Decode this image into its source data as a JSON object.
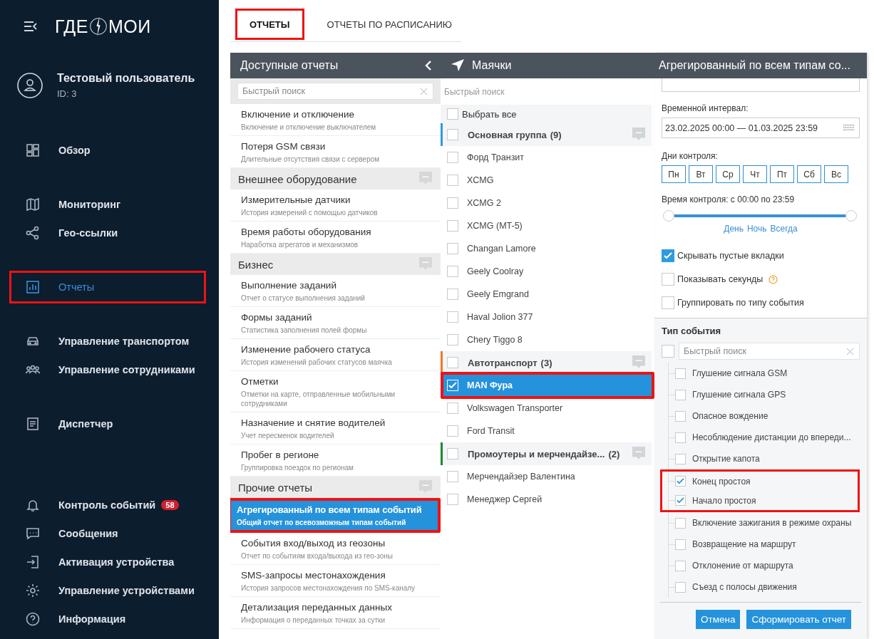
{
  "sidebar": {
    "logo": {
      "left": "ГДЕ",
      "right": "МОИ"
    },
    "user": {
      "name": "Тестовый пользователь",
      "id": "ID: 3"
    },
    "groups": [
      [
        {
          "label": "Обзор",
          "selected": false,
          "highlighted": false
        }
      ],
      [
        {
          "label": "Мониторинг",
          "selected": false,
          "highlighted": false
        },
        {
          "label": "Гео-ссылки",
          "selected": false,
          "highlighted": false
        }
      ],
      [
        {
          "label": "Отчеты",
          "selected": true,
          "highlighted": true
        }
      ],
      [
        {
          "label": "Управление транспортом",
          "selected": false,
          "highlighted": false
        },
        {
          "label": "Управление сотрудниками",
          "selected": false,
          "highlighted": false
        }
      ],
      [
        {
          "label": "Диспетчер",
          "selected": false,
          "highlighted": false
        }
      ],
      [
        {
          "label": "Контроль событий",
          "badge": "58",
          "selected": false,
          "highlighted": false
        },
        {
          "label": "Сообщения",
          "selected": false,
          "highlighted": false
        },
        {
          "label": "Активация устройства",
          "selected": false,
          "highlighted": false
        },
        {
          "label": "Управление устройствами",
          "selected": false,
          "highlighted": false
        },
        {
          "label": "Информация",
          "selected": false,
          "highlighted": false
        }
      ]
    ]
  },
  "tabs": [
    {
      "label": "ОТЧЕТЫ",
      "selected": true,
      "highlighted": true
    },
    {
      "label": "ОТЧЕТЫ ПО РАСПИСАНИЮ",
      "selected": false,
      "highlighted": false
    }
  ],
  "reports": {
    "title": "Доступные отчеты",
    "search": {
      "placeholder": "Быстрый поиск"
    },
    "rows": [
      {
        "kind": "item",
        "title": "Включение и отключение",
        "description": "Включение и отключение выключателем",
        "selected": false,
        "highlighted": false
      },
      {
        "kind": "item",
        "title": "Потеря GSM связи",
        "description": "Длительные отсутствия связи с сервером",
        "selected": false,
        "highlighted": false
      },
      {
        "kind": "group",
        "title": "Внешнее оборудование"
      },
      {
        "kind": "item",
        "title": "Измерительные датчики",
        "description": "История измерений с помощью датчиков",
        "selected": false,
        "highlighted": false
      },
      {
        "kind": "item",
        "title": "Время работы оборудования",
        "description": "Наработка агрегатов и механизмов",
        "selected": false,
        "highlighted": false
      },
      {
        "kind": "group",
        "title": "Бизнес"
      },
      {
        "kind": "item",
        "title": "Выполнение заданий",
        "description": "Отчет о статусе выполнения заданий",
        "selected": false,
        "highlighted": false
      },
      {
        "kind": "item",
        "title": "Формы заданий",
        "description": "Статистика заполнения полей формы",
        "selected": false,
        "highlighted": false
      },
      {
        "kind": "item",
        "title": "Изменение рабочего статуса",
        "description": "История изменений рабочих статусов маячка",
        "selected": false,
        "highlighted": false
      },
      {
        "kind": "item",
        "title": "Отметки",
        "description": "Отметки на карте, отправленные мобильными сотрудниками",
        "selected": false,
        "highlighted": false
      },
      {
        "kind": "item",
        "title": "Назначение и снятие водителей",
        "description": "Учет пересменок водителей",
        "selected": false,
        "highlighted": false
      },
      {
        "kind": "item",
        "title": "Пробег в регионе",
        "description": "Группировка поездок по регионам",
        "selected": false,
        "highlighted": false
      },
      {
        "kind": "group",
        "title": "Прочие отчеты"
      },
      {
        "kind": "item",
        "title": "Агрегированный по всем типам событий",
        "description": "Общий отчет по всевозможным типам событий",
        "selected": true,
        "highlighted": true
      },
      {
        "kind": "item",
        "title": "События вход/выход из геозоны",
        "description": "Отчет по событиям входа/выхода из гео-зоны",
        "selected": false,
        "highlighted": false
      },
      {
        "kind": "item",
        "title": "SMS-запросы местонахождения",
        "description": "История запросов местонахождения по SMS-каналу",
        "selected": false,
        "highlighted": false
      },
      {
        "kind": "item",
        "title": "Детализация переданных данных",
        "description": "Информация о переданных точках за сутки",
        "selected": false,
        "highlighted": false
      }
    ]
  },
  "beacons": {
    "title": "Маячки",
    "search": {
      "placeholder": "Быстрый поиск"
    },
    "select_all": {
      "label": "Выбрать все",
      "checked": false
    },
    "rows": [
      {
        "kind": "group",
        "label": "Основная группа",
        "count": "(9)",
        "color": "#2d9be0",
        "checked": false
      },
      {
        "kind": "item",
        "label": "Форд Транзит",
        "checked": false,
        "selected": false,
        "highlighted": false
      },
      {
        "kind": "item",
        "label": "XCMG",
        "checked": false,
        "selected": false,
        "highlighted": false
      },
      {
        "kind": "item",
        "label": "XCMG 2",
        "checked": false,
        "selected": false,
        "highlighted": false
      },
      {
        "kind": "item",
        "label": "XCMG (MT-5)",
        "checked": false,
        "selected": false,
        "highlighted": false
      },
      {
        "kind": "item",
        "label": "Changan Lamore",
        "checked": false,
        "selected": false,
        "highlighted": false
      },
      {
        "kind": "item",
        "label": "Geely Coolray",
        "checked": false,
        "selected": false,
        "highlighted": false
      },
      {
        "kind": "item",
        "label": "Geely Emgrand",
        "checked": false,
        "selected": false,
        "highlighted": false
      },
      {
        "kind": "item",
        "label": "Haval Jolion 377",
        "checked": false,
        "selected": false,
        "highlighted": false
      },
      {
        "kind": "item",
        "label": "Chery Tiggo 8",
        "checked": false,
        "selected": false,
        "highlighted": false
      },
      {
        "kind": "group",
        "label": "Автотранспорт",
        "count": "(3)",
        "color": "#f0782d",
        "checked": false
      },
      {
        "kind": "item",
        "label": "MAN Фура",
        "checked": true,
        "selected": true,
        "highlighted": true
      },
      {
        "kind": "item",
        "label": "Volkswagen Transporter",
        "checked": false,
        "selected": false,
        "highlighted": false
      },
      {
        "kind": "item",
        "label": "Ford Transit",
        "checked": false,
        "selected": false,
        "highlighted": false
      },
      {
        "kind": "group",
        "label": "Промоутеры и мерчендайзе...",
        "count": "(2)",
        "color": "#1a8a2a",
        "checked": false
      },
      {
        "kind": "item",
        "label": "Мерчендайзер Валентина",
        "checked": false,
        "selected": false,
        "highlighted": false
      },
      {
        "kind": "item",
        "label": "Менеджер Сергей",
        "checked": false,
        "selected": false,
        "highlighted": false
      }
    ]
  },
  "report_form": {
    "title": "Агрегированный по всем типам со...",
    "interval": {
      "label": "Временной интервал:",
      "value": "23.02.2025 00:00 — 01.03.2025 23:59"
    },
    "days": {
      "label": "Дни контроля:",
      "items": [
        {
          "label": "Пн",
          "selected": false
        },
        {
          "label": "Вт",
          "selected": false
        },
        {
          "label": "Ср",
          "selected": false
        },
        {
          "label": "Чт",
          "selected": false
        },
        {
          "label": "Пт",
          "selected": false
        },
        {
          "label": "Сб",
          "selected": false
        },
        {
          "label": "Вс",
          "selected": false
        }
      ]
    },
    "time": {
      "label": "Время контроля: с 00:00 по 23:59",
      "slider": {
        "level": 1
      },
      "presets": [
        "День",
        "Ночь",
        "Всегда"
      ]
    },
    "options": [
      {
        "label": "Скрывать пустые вкладки",
        "checked": true,
        "help": false
      },
      {
        "label": "Показывать секунды",
        "checked": false,
        "help": true
      },
      {
        "label": "Группировать по типу события",
        "checked": false,
        "help": false
      }
    ],
    "event_types": {
      "title": "Тип события",
      "select_all": {
        "checked": false
      },
      "search": {
        "placeholder": "Быстрый поиск"
      },
      "items": [
        {
          "label": "Глушение сигнала GSM",
          "checked": false,
          "highlighted": false
        },
        {
          "label": "Глушение сигнала GPS",
          "checked": false,
          "highlighted": false
        },
        {
          "label": "Опасное вождение",
          "checked": false,
          "highlighted": false
        },
        {
          "label": "Несоблюдение дистанции до впереди...",
          "checked": false,
          "highlighted": false
        },
        {
          "label": "Открытие капота",
          "checked": false,
          "highlighted": false
        },
        {
          "label": "Конец простоя",
          "checked": true,
          "highlighted": true
        },
        {
          "label": "Начало простоя",
          "checked": true,
          "highlighted": true
        },
        {
          "label": "Включение зажигания в режиме охраны",
          "checked": false,
          "highlighted": false
        },
        {
          "label": "Возвращение на маршрут",
          "checked": false,
          "highlighted": false
        },
        {
          "label": "Отклонение от маршрута",
          "checked": false,
          "highlighted": false
        },
        {
          "label": "Съезд с полосы движения",
          "checked": false,
          "highlighted": false
        }
      ]
    },
    "buttons": [
      {
        "label": "Отмена"
      },
      {
        "label": "Сформировать отчет"
      }
    ]
  }
}
